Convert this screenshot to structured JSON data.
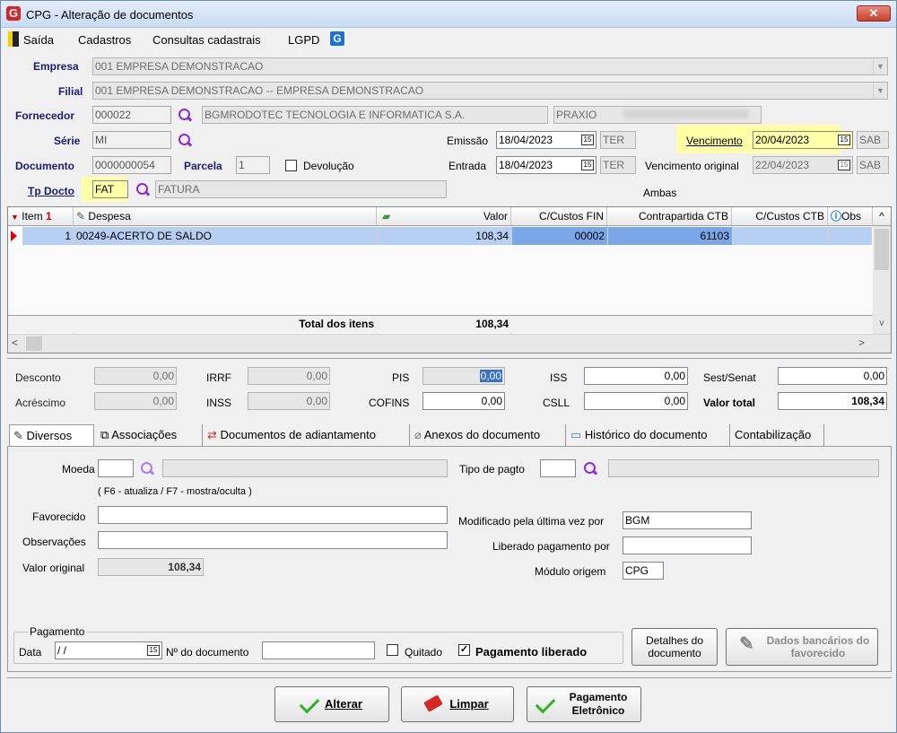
{
  "window": {
    "title": "CPG - Alteração de documentos",
    "close": "✕"
  },
  "menu": [
    "Saída",
    "Cadastros",
    "Consultas cadastrais",
    "LGPD"
  ],
  "form": {
    "empresa_label": "Empresa",
    "empresa_value": "001 EMPRESA DEMONSTRACAO",
    "filial_label": "Filial",
    "filial_value": "001 EMPRESA DEMONSTRACAO -- EMPRESA DEMONSTRACAO",
    "fornecedor_label": "Fornecedor",
    "fornecedor_code": "000022",
    "fornecedor_name": "BGMRODOTEC TECNOLOGIA E INFORMATICA S.A.",
    "fornecedor_extra": "PRAXIO",
    "serie_label": "Série",
    "serie_value": "MI",
    "documento_label": "Documento",
    "documento_value": "0000000054",
    "parcela_label": "Parcela",
    "parcela_value": "1",
    "devolucao_label": "Devolução",
    "tpdocto_label": "Tp Docto",
    "tpdocto_code": "FAT",
    "tpdocto_name": "FATURA",
    "emissao_label": "Emissão",
    "emissao_value": "18/04/2023",
    "emissao_day": "TER",
    "entrada_label": "Entrada",
    "entrada_value": "18/04/2023",
    "entrada_day": "TER",
    "vencimento_label": "Vencimento",
    "vencimento_value": "20/04/2023",
    "vencimento_day": "SAB",
    "venc_original_label": "Vencimento original",
    "venc_original_value": "22/04/2023",
    "venc_original_day": "SAB",
    "ambas": "Ambas"
  },
  "grid": {
    "headers": {
      "item": "Item",
      "despesa": "Despesa",
      "valor": "Valor",
      "ccfin": "C/Custos FIN",
      "contrapartida": "Contrapartida CTB",
      "ccctb": "C/Custos CTB",
      "obs": "Obs"
    },
    "rows": [
      {
        "item": "1",
        "despesa": "00249-ACERTO DE SALDO",
        "valor": "108,34",
        "ccfin": "00002",
        "contrapartida": "61103"
      }
    ],
    "total_label": "Total dos itens",
    "total_value": "108,34"
  },
  "totals": {
    "desconto_label": "Desconto",
    "desconto": "0,00",
    "acrescimo_label": "Acréscimo",
    "acrescimo": "0,00",
    "irrf_label": "IRRF",
    "irrf": "0,00",
    "inss_label": "INSS",
    "inss": "0,00",
    "pis_label": "PIS",
    "pis": "0,00",
    "cofins_label": "COFINS",
    "cofins": "0,00",
    "iss_label": "ISS",
    "iss": "0,00",
    "csll_label": "CSLL",
    "csll": "0,00",
    "sest_label": "Sest/Senat",
    "sest": "0,00",
    "valortotal_label": "Valor total",
    "valortotal": "108,34"
  },
  "tabs": [
    "Diversos",
    "Associações",
    "Documentos de adiantamento",
    "Anexos do documento",
    "Histórico do documento",
    "Contabilização"
  ],
  "diversos": {
    "moeda_label": "Moeda",
    "moeda_value": "",
    "tipopagto_label": "Tipo de pagto",
    "tipopagto_value": "",
    "hint": "( F6 - atualiza / F7 - mostra/oculta )",
    "favorecido_label": "Favorecido",
    "favorecido_value": "",
    "observacoes_label": "Observações",
    "observacoes_value": "",
    "valororiginal_label": "Valor original",
    "valororiginal_value": "108,34",
    "modificado_label": "Modificado pela última vez por",
    "modificado_value": "BGM",
    "liberado_label": "Liberado pagamento por",
    "liberado_value": "",
    "modulo_label": "Módulo origem",
    "modulo_value": "CPG",
    "pagamento_group": "Pagamento",
    "data_label": "Data",
    "data_value": "/ /",
    "ndoc_label": "Nº do documento",
    "ndoc_value": "",
    "quitado_label": "Quitado",
    "pagliberado_label": "Pagamento liberado",
    "detalhes_btn": "Detalhes do documento",
    "dados_btn": "Dados bancários do favorecido"
  },
  "buttons": {
    "alterar": "Alterar",
    "limpar": "Limpar",
    "pagamento": "Pagamento Eletrônico"
  }
}
